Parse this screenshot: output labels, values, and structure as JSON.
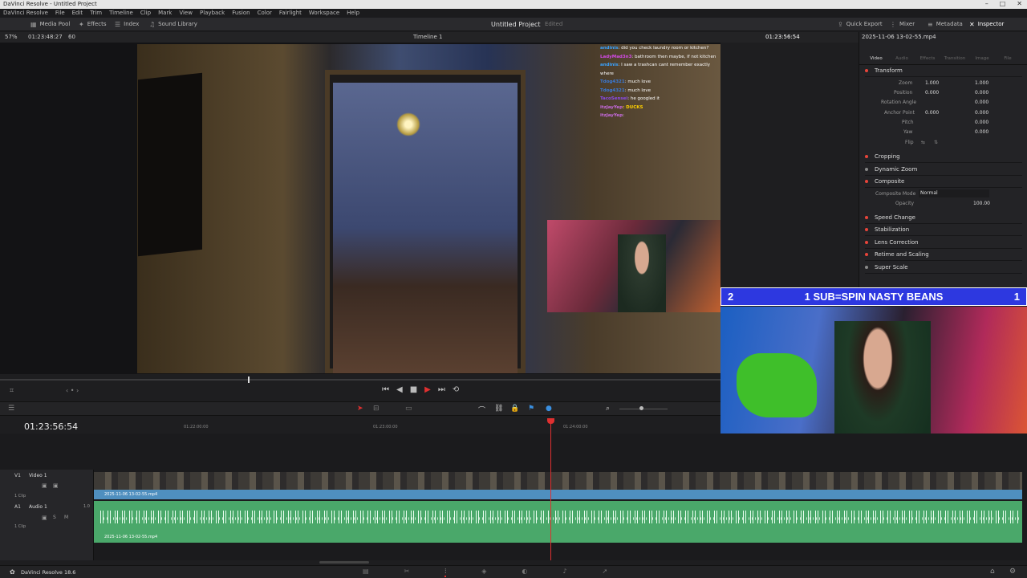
{
  "window": {
    "title": "DaVinci Resolve - Untitled Project",
    "controls": [
      "–",
      "□",
      "✕"
    ]
  },
  "menu": [
    "DaVinci Resolve",
    "File",
    "Edit",
    "Trim",
    "Timeline",
    "Clip",
    "Mark",
    "View",
    "Playback",
    "Fusion",
    "Color",
    "Fairlight",
    "Workspace",
    "Help"
  ],
  "toolbar": {
    "media_pool": "Media Pool",
    "effects": "Effects",
    "index": "Index",
    "sound_library": "Sound Library",
    "project_name": "Untitled Project",
    "project_status": "Edited",
    "quick_export": "Quick Export",
    "mixer": "Mixer",
    "metadata": "Metadata",
    "inspector": "Inspector"
  },
  "viewer": {
    "zoom": "57%",
    "source_timecode": "01:23:48:27",
    "frame_rate_suffix": "60",
    "timeline_name": "Timeline 1",
    "record_timecode": "01:23:56:54"
  },
  "chat": [
    {
      "user": "andinis",
      "msg": ": did you check laundry room or kitchen?",
      "color": "#3ba3ff"
    },
    {
      "user": "LadyMad3n3",
      "msg": ": bathroom then maybe, if not kitchen",
      "color": "#d44ae8"
    },
    {
      "user": "andinis",
      "msg": ": I saw a trashcan cant remember exactly where",
      "color": "#3ba3ff"
    },
    {
      "user": "Tdog4321",
      "msg": ": much love",
      "color": "#3a7ad8"
    },
    {
      "user": "Tdog4321",
      "msg": ": much love",
      "color": "#3a7ad8"
    },
    {
      "user": "TacoSensei",
      "msg": ": he googled it",
      "color": "#8a4ae8"
    },
    {
      "user": "itzJayYep",
      "msg": ": DUCKS",
      "color": "#c86ae0"
    },
    {
      "user": "itzJayYep",
      "msg": ":",
      "color": "#c86ae0"
    }
  ],
  "banner": {
    "left": "2",
    "center": "1 SUB=SPIN NASTY BEANS",
    "right": "1"
  },
  "inspector": {
    "file": "2025-11-06 13-02-55.mp4",
    "tabs": [
      "Video",
      "Audio",
      "Effects",
      "Transition",
      "Image",
      "File"
    ],
    "transform": "Transform",
    "zoom_label": "Zoom",
    "zoom_x": "1.000",
    "zoom_y": "1.000",
    "position_label": "Position",
    "position_x": "0.000",
    "position_y": "0.000",
    "rotation_label": "Rotation Angle",
    "rotation": "0.000",
    "anchor_label": "Anchor Point",
    "anchor_x": "0.000",
    "anchor_y": "0.000",
    "pitch_label": "Pitch",
    "pitch": "0.000",
    "yaw_label": "Yaw",
    "yaw": "0.000",
    "flip_label": "Flip",
    "cropping": "Cropping",
    "dynamic_zoom": "Dynamic Zoom",
    "composite": "Composite",
    "composite_mode_label": "Composite Mode",
    "composite_mode": "Normal",
    "opacity_label": "Opacity",
    "opacity": "100.00",
    "speed_change": "Speed Change",
    "stabilization": "Stabilization",
    "lens_correction": "Lens Correction",
    "retime": "Retime and Scaling",
    "super_scale": "Super Scale",
    "accent": "#e8443a"
  },
  "timeline": {
    "timecode": "01:23:56:54",
    "ruler": [
      "01:22:00:00",
      "01:23:00:00",
      "01:24:00:00"
    ],
    "video_track": {
      "id": "V1",
      "name": "Video 1",
      "clips": "1 Clip",
      "clip_name": "2025-11-06 13-02-55.mp4"
    },
    "audio_track": {
      "id": "A1",
      "name": "Audio 1",
      "level": "1.0",
      "clips": "1 Clip",
      "clip_name": "2025-11-06 13-02-55.mp4"
    }
  },
  "status": {
    "app": "DaVinci Resolve 18.6"
  }
}
